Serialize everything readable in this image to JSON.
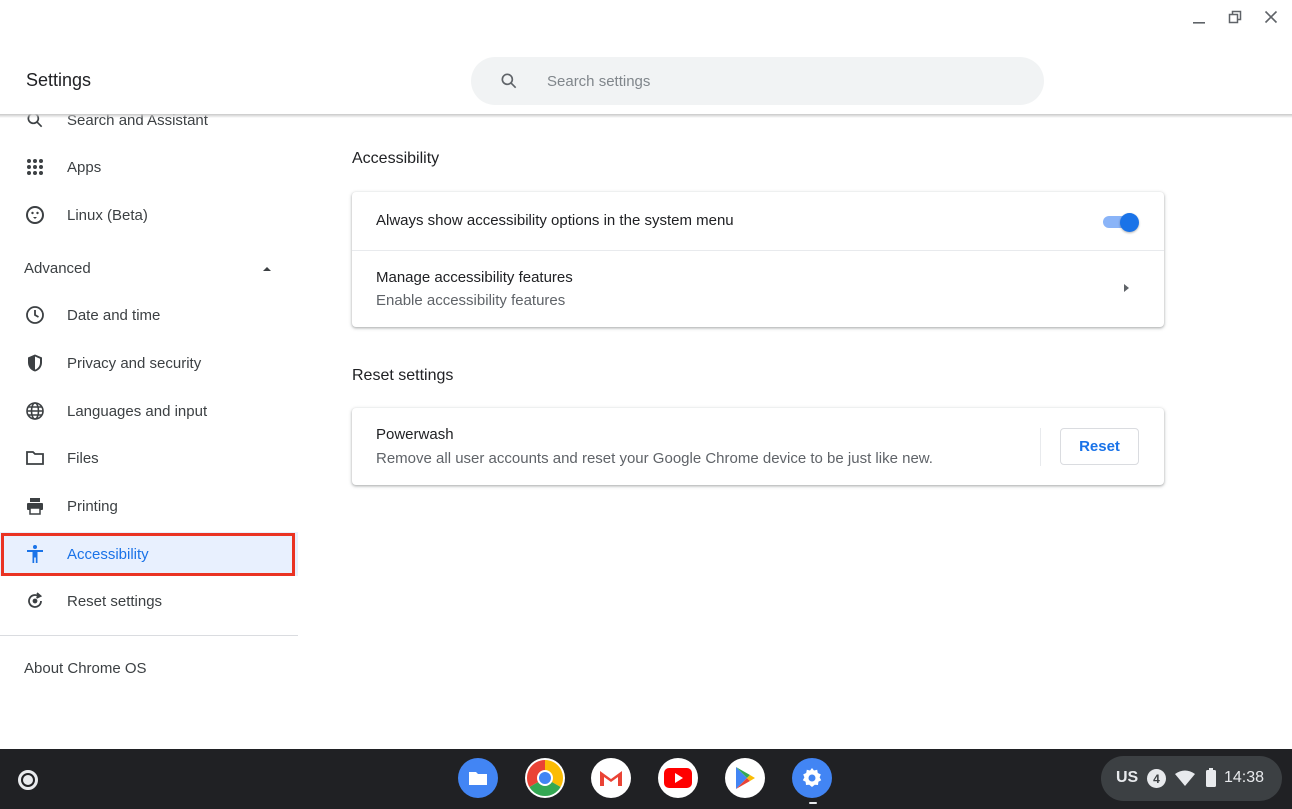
{
  "window": {
    "title": "Settings",
    "controls": [
      "minimize",
      "maximize",
      "close"
    ]
  },
  "search": {
    "placeholder": "Search settings"
  },
  "sidebar": {
    "items": [
      {
        "label": "Search and Assistant",
        "icon": "search-icon"
      },
      {
        "label": "Apps",
        "icon": "apps-grid-icon"
      },
      {
        "label": "Linux (Beta)",
        "icon": "linux-penguin-icon"
      }
    ],
    "advanced_label": "Advanced",
    "advanced_items": [
      {
        "label": "Date and time",
        "icon": "clock-icon"
      },
      {
        "label": "Privacy and security",
        "icon": "shield-icon"
      },
      {
        "label": "Languages and input",
        "icon": "globe-icon"
      },
      {
        "label": "Files",
        "icon": "folder-icon"
      },
      {
        "label": "Printing",
        "icon": "printer-icon"
      },
      {
        "label": "Accessibility",
        "icon": "accessibility-icon",
        "active": true
      },
      {
        "label": "Reset settings",
        "icon": "reset-icon"
      }
    ],
    "about_label": "About Chrome OS"
  },
  "main": {
    "accessibility": {
      "title": "Accessibility",
      "always_show_label": "Always show accessibility options in the system menu",
      "always_show_enabled": true,
      "manage_label": "Manage accessibility features",
      "manage_sublabel": "Enable accessibility features"
    },
    "reset": {
      "title": "Reset settings",
      "powerwash_label": "Powerwash",
      "powerwash_sublabel": "Remove all user accounts and reset your Google Chrome device to be just like new.",
      "reset_button": "Reset"
    }
  },
  "shelf": {
    "apps": [
      "files-app-icon",
      "chrome-app-icon",
      "gmail-app-icon",
      "youtube-app-icon",
      "play-store-app-icon",
      "settings-app-icon"
    ],
    "tray": {
      "ime": "US",
      "notifications": "4",
      "time": "14:38"
    }
  },
  "colors": {
    "accent": "#1a73e8",
    "highlight_border": "#ea3323",
    "shelf_bg": "#202124"
  }
}
